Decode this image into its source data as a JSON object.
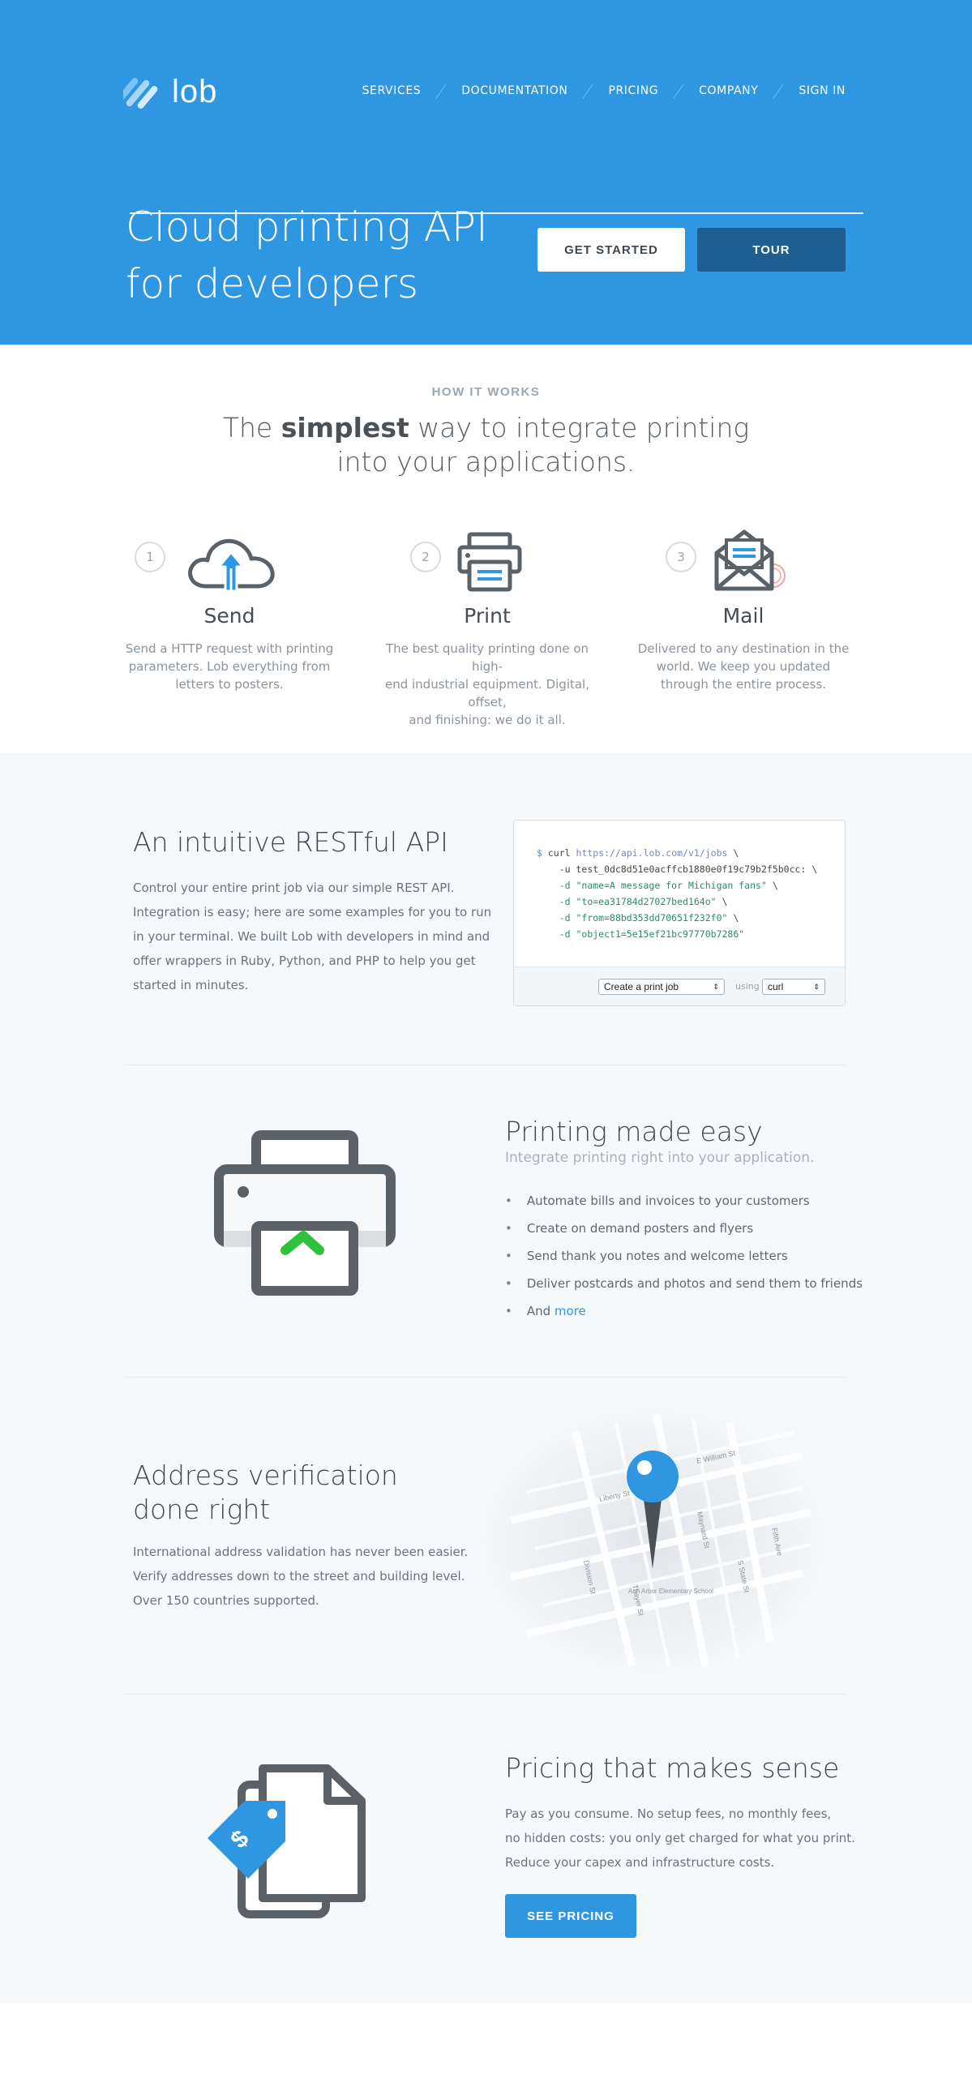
{
  "header": {
    "logo_text": "lob",
    "nav": [
      {
        "label": "SERVICES"
      },
      {
        "label": "DOCUMENTATION"
      },
      {
        "label": "PRICING"
      },
      {
        "label": "COMPANY"
      },
      {
        "label": "SIGN IN"
      }
    ]
  },
  "hero": {
    "title_line1": "Cloud printing API",
    "title_line2": "for developers",
    "get_started": "GET STARTED",
    "tour": "TOUR"
  },
  "how_it_works": {
    "eyebrow": "HOW IT WORKS",
    "heading_pre": "The ",
    "heading_bold": "simplest",
    "heading_post": " way to integrate printing",
    "heading_line2": "into your applications.",
    "steps": [
      {
        "num": "1",
        "title": "Send",
        "icon": "cloud-upload-icon",
        "desc1": "Send a HTTP request with printing",
        "desc2": "parameters. Lob everything from",
        "desc3": "letters to posters."
      },
      {
        "num": "2",
        "title": "Print",
        "icon": "printer-icon",
        "desc1": "The best quality printing done on high-",
        "desc2": "end industrial equipment. Digital, offset,",
        "desc3": "and finishing: we do it all."
      },
      {
        "num": "3",
        "title": "Mail",
        "icon": "envelope-icon",
        "desc1": "Delivered to any destination in the",
        "desc2": "world. We keep you updated",
        "desc3": "through the entire process."
      }
    ]
  },
  "api": {
    "title": "An intuitive RESTful API",
    "body1": "Control your entire print job via our simple REST API.",
    "body2": "Integration is easy; here are some examples for you to run",
    "body3": "in  your terminal. We built Lob with developers in mind and",
    "body4": "offer  wrappers in Ruby, Python, and PHP to help you get",
    "body5": "started in minutes.",
    "code": {
      "prompt": "$",
      "cmd": "curl",
      "url": "https://api.lob.com/v1/jobs",
      "lines": [
        "-u test_0dc8d51e0acffcb1880e0f19c79b2f5b0cc:",
        "-d \"name=A message for Michigan fans\"",
        "-d \"to=ea31784d27027bed164o\"",
        "-d \"from=88bd353dd70651f232f0\"",
        "-d \"object1=5e15ef21bc97770b7286\""
      ],
      "select_action": "Create a print job",
      "using_label": "using",
      "select_lang": "curl"
    },
    "colors": {
      "accent": "#2f97e2",
      "code_string": "#2a8a6a",
      "code_url": "#7a86c4"
    }
  },
  "printing": {
    "title": "Printing made easy",
    "subtitle": "Integrate printing right into your application.",
    "items": [
      "Automate bills and invoices to your customers",
      "Create on demand posters and flyers",
      "Send thank you notes and welcome letters",
      "Deliver postcards and photos and send them to friends"
    ],
    "last_prefix": "And ",
    "last_link": "more"
  },
  "address": {
    "title_line1": "Address verification",
    "title_line2": "done right",
    "body1": "International address validation has never been easier.",
    "body2": "Verify  addresses down to the street and building level.",
    "body3": "Over 150 countries supported.",
    "map_labels": [
      "Liberty St",
      "Division St",
      "E William St",
      "Maynard St",
      "Thayer St",
      "S State St",
      "Fifth Ave",
      "Ann Arbor Elementary School"
    ]
  },
  "pricing": {
    "title": "Pricing that makes sense",
    "body1": "Pay as you consume. No setup fees, no monthly fees,",
    "body2": "no hidden costs: you only get charged for what you print.",
    "body3": "Reduce your capex and infrastructure costs.",
    "button": "SEE PRICING",
    "tag_symbol": "$"
  }
}
